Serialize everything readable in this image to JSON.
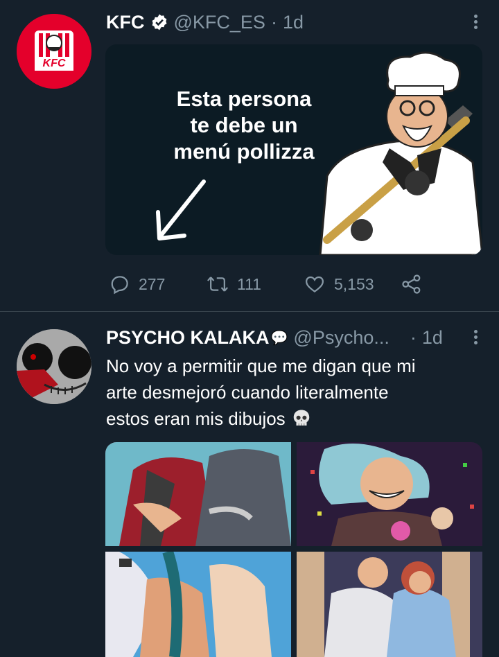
{
  "tweets": [
    {
      "author": "KFC",
      "handle": "@KFC_ES",
      "separator": "·",
      "time": "1d",
      "avatar_logo": "KFC",
      "avatar_color": "#e4002b",
      "media": {
        "text_lines": [
          "Esta persona",
          "te debe un",
          "menú pollizza"
        ]
      },
      "actions": {
        "replies": "277",
        "retweets": "111",
        "likes": "5,153"
      },
      "icons": [
        "reply-icon",
        "retweet-icon",
        "like-icon",
        "share-icon"
      ]
    },
    {
      "author": "PSYCHO KALAKA",
      "name_emoji": "💬",
      "handle": "@Psycho...",
      "separator": "·",
      "time": "1d",
      "text_lines": [
        "No voy a permitir que me digan que mi",
        "arte desmejoró cuando literalmente",
        "estos eran mis dibujos"
      ],
      "text_emoji": "skull-emoji",
      "media_count": 4
    }
  ],
  "theme": {
    "background": "#15202b",
    "secondary_text": "#8899a6",
    "divider": "#38444d"
  }
}
